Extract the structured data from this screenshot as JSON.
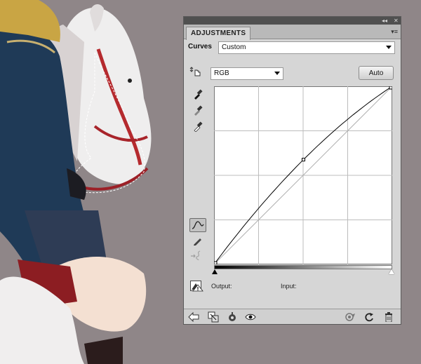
{
  "panel": {
    "collapse_glyph": "◂◂",
    "close_glyph": "✕",
    "tab_label": "ADJUSTMENTS",
    "menu_glyph": "▾≡",
    "adjustment_name": "Curves",
    "preset": {
      "selected": "Custom"
    },
    "channel": {
      "selected": "RGB"
    },
    "auto_label": "Auto",
    "output_label": "Output:",
    "input_label": "Input:"
  },
  "curve": {
    "points": [
      [
        0,
        0
      ],
      [
        128,
        150
      ],
      [
        255,
        255
      ]
    ],
    "baseline": [
      [
        0,
        0
      ],
      [
        255,
        255
      ]
    ],
    "grid_divisions": 4
  },
  "colors": {
    "canvas_bg": "#8f8688",
    "panel_bg": "#d6d6d6",
    "titlebar": "#505050",
    "curve_line": "#000000",
    "grid_line": "#bcbcbc"
  },
  "tools": {
    "left_column": [
      "target-adjust-icon",
      "black-point-eyedropper-icon",
      "gray-point-eyedropper-icon",
      "white-point-eyedropper-icon",
      "curve-point-tool-icon",
      "pencil-draw-icon",
      "smooth-curve-icon"
    ],
    "bottom_bar": [
      "back-arrow-icon",
      "clip-to-layer-icon",
      "visibility-toggle-icon",
      "eye-icon",
      "previous-state-icon",
      "reset-icon",
      "trash-icon"
    ]
  }
}
